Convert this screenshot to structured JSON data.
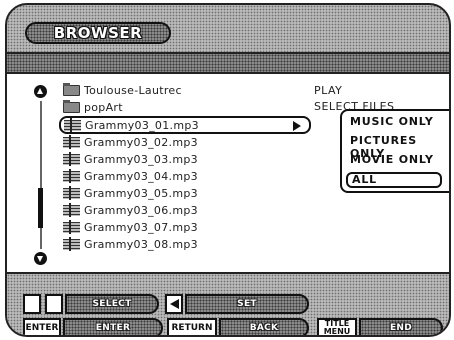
{
  "window": {
    "title": "BROWSER"
  },
  "file_list": {
    "items": [
      {
        "name": "Toulouse-Lautrec",
        "type": "folder",
        "icon": "folder-icon",
        "selected": false
      },
      {
        "name": "popArt",
        "type": "folder",
        "icon": "folder-icon",
        "selected": false
      },
      {
        "name": "Grammy03_01.mp3",
        "type": "file",
        "icon": "music-file-icon",
        "selected": true
      },
      {
        "name": "Grammy03_02.mp3",
        "type": "file",
        "icon": "music-file-icon",
        "selected": false
      },
      {
        "name": "Grammy03_03.mp3",
        "type": "file",
        "icon": "music-file-icon",
        "selected": false
      },
      {
        "name": "Grammy03_04.mp3",
        "type": "file",
        "icon": "music-file-icon",
        "selected": false
      },
      {
        "name": "Grammy03_05.mp3",
        "type": "file",
        "icon": "music-file-icon",
        "selected": false
      },
      {
        "name": "Grammy03_06.mp3",
        "type": "file",
        "icon": "music-file-icon",
        "selected": false
      },
      {
        "name": "Grammy03_07.mp3",
        "type": "file",
        "icon": "music-file-icon",
        "selected": false
      },
      {
        "name": "Grammy03_08.mp3",
        "type": "file",
        "icon": "music-file-icon",
        "selected": false
      }
    ]
  },
  "side_menu": {
    "play": "PLAY",
    "select_files": "SELECT FILES",
    "options": [
      "MUSIC ONLY",
      "PICTURES ONLY",
      "MOVIE ONLY",
      "ALL"
    ],
    "selected_option": "ALL"
  },
  "guide": {
    "row1": [
      {
        "keys": [
          "up-arrow-icon",
          "down-arrow-icon"
        ],
        "action": "SELECT"
      },
      {
        "keys": [
          "left-arrow-icon"
        ],
        "action": "SET"
      }
    ],
    "row2": [
      {
        "key": "ENTER",
        "action": "ENTER"
      },
      {
        "key": "RETURN",
        "action": "BACK"
      },
      {
        "key_line1": "TITLE",
        "key_line2": "MENU",
        "action": "END"
      }
    ]
  },
  "colors": {
    "text": "#222222",
    "halftone_light": "#b9b9b9",
    "halftone_dark": "#8a8a8a"
  }
}
